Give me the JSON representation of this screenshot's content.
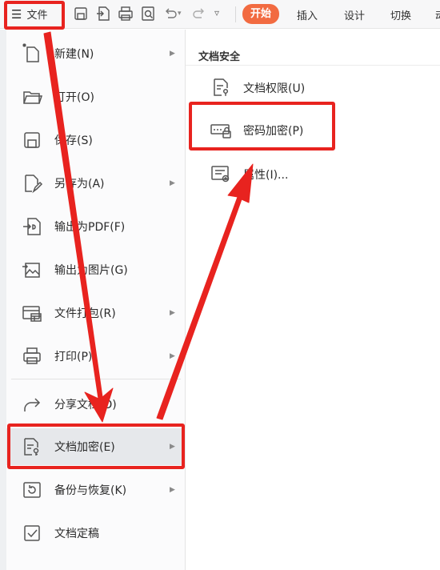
{
  "toolbar": {
    "file_label": "文件",
    "tabs": [
      "开始",
      "插入",
      "设计",
      "切换",
      "动"
    ]
  },
  "menu": {
    "items": [
      {
        "label": "新建(N)",
        "icon": "new-doc-icon",
        "submenu": true
      },
      {
        "label": "打开(O)",
        "icon": "folder-icon",
        "submenu": false
      },
      {
        "label": "保存(S)",
        "icon": "save-icon",
        "submenu": false
      },
      {
        "label": "另存为(A)",
        "icon": "save-as-icon",
        "submenu": true
      },
      {
        "label": "输出为PDF(F)",
        "icon": "pdf-icon",
        "submenu": false
      },
      {
        "label": "输出为图片(G)",
        "icon": "image-icon",
        "submenu": false
      },
      {
        "label": "文件打包(R)",
        "icon": "package-icon",
        "submenu": true
      },
      {
        "label": "打印(P)",
        "icon": "printer-icon",
        "submenu": true
      },
      {
        "label": "分享文档(D)",
        "icon": "share-icon",
        "submenu": false
      },
      {
        "label": "文档加密(E)",
        "icon": "doc-key-icon",
        "submenu": true
      },
      {
        "label": "备份与恢复(K)",
        "icon": "backup-icon",
        "submenu": true
      },
      {
        "label": "文档定稿",
        "icon": "finalize-icon",
        "submenu": false
      }
    ]
  },
  "submenu": {
    "heading": "文档安全",
    "items": [
      {
        "label": "文档权限(U)",
        "icon": "doc-permission-icon"
      },
      {
        "label": "密码加密(P)",
        "icon": "password-lock-icon"
      },
      {
        "label": "属性(I)...",
        "icon": "properties-icon"
      }
    ]
  },
  "colors": {
    "annotation_red": "#e8231f",
    "active_tab": "#f26b41"
  }
}
